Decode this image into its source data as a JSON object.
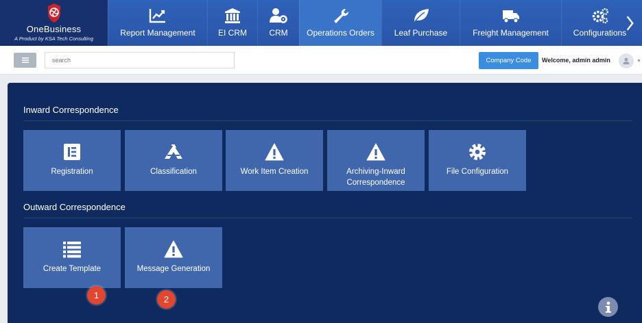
{
  "brand": {
    "name": "OneBusiness",
    "tagline": "A Product by KSA Tech Consulting"
  },
  "nav": {
    "items": [
      {
        "label": "Report Management",
        "icon": "chart-icon"
      },
      {
        "label": "EI CRM",
        "icon": "bank-icon"
      },
      {
        "label": "CRM",
        "icon": "users-gear-icon"
      },
      {
        "label": "Operations Orders",
        "icon": "wrench-icon"
      },
      {
        "label": "Leaf Purchase",
        "icon": "leaf-icon"
      },
      {
        "label": "Freight Management",
        "icon": "truck-icon"
      },
      {
        "label": "Configurations",
        "icon": "gears-icon"
      }
    ]
  },
  "toolbar": {
    "search_placeholder": "search",
    "company_code_label": "Company Code",
    "welcome_text": "Welcome, admin admin"
  },
  "inward": {
    "title": "Inward Correspondence",
    "tiles": [
      {
        "label": "Registration",
        "icon": "form-icon"
      },
      {
        "label": "Classification",
        "icon": "classification-icon"
      },
      {
        "label": "Work Item Creation",
        "icon": "warning-icon"
      },
      {
        "label": "Archiving-Inward Correspondence",
        "icon": "warning-icon"
      },
      {
        "label": "File Configuration",
        "icon": "gear-icon"
      }
    ]
  },
  "outward": {
    "title": "Outward Correspondence",
    "tiles": [
      {
        "label": "Create Template",
        "icon": "list-icon"
      },
      {
        "label": "Message Generation",
        "icon": "warning-icon"
      }
    ]
  },
  "badges": [
    "1",
    "2"
  ],
  "colors": {
    "nav": "#2e62b8",
    "brand": "#16316e",
    "panel": "#0e2a5f",
    "tile": "#4066ac",
    "badge": "#e0472e",
    "button": "#3a8de0"
  }
}
